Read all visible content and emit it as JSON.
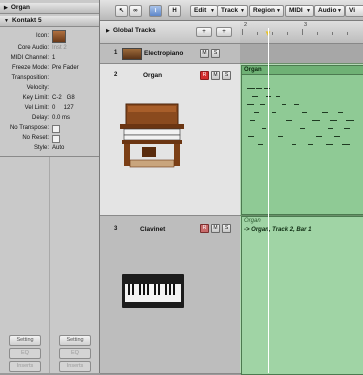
{
  "inspector": {
    "region_header": "Organ",
    "plugin_header": "Kontakt 5",
    "params": [
      {
        "label": "Icon:",
        "value": ""
      },
      {
        "label": "Core Audio:",
        "value": "Inst 2"
      },
      {
        "label": "MIDI Channel:",
        "value": "1"
      },
      {
        "label": "Freeze Mode:",
        "value": "Pre Fader"
      },
      {
        "label": "Transposition:",
        "value": ""
      },
      {
        "label": "Velocity:",
        "value": ""
      },
      {
        "label": "Key Limit:",
        "value": "C-2   G8"
      },
      {
        "label": "Vel Limit:",
        "value": "0     127"
      },
      {
        "label": "Delay:",
        "value": "0.0 ms"
      },
      {
        "label": "No Transpose:",
        "value": ""
      },
      {
        "label": "No Reset:",
        "value": ""
      },
      {
        "label": "Style:",
        "value": "Auto"
      }
    ],
    "buttons": {
      "setting": "Setting",
      "eq": "EQ",
      "inserts": "Inserts"
    }
  },
  "toolbar": {
    "edit": "Edit",
    "track": "Track",
    "region": "Region",
    "midi": "MIDI",
    "audio": "Audio",
    "view": "Vi",
    "h_label": "H"
  },
  "global_tracks": {
    "label": "Global Tracks",
    "add": "+",
    "add2": "+"
  },
  "ruler": {
    "marks": [
      "2",
      "3"
    ]
  },
  "tracks": [
    {
      "number": "1",
      "name": "Electropiano",
      "mute": "M",
      "solo": "S"
    },
    {
      "number": "2",
      "name": "Organ",
      "record": "R",
      "mute": "M",
      "solo": "S"
    },
    {
      "number": "3",
      "name": "Clavinet",
      "record": "R",
      "mute": "M",
      "solo": "S"
    }
  ],
  "regions": {
    "organ": {
      "title": "Organ"
    },
    "alias": {
      "title": "Organ",
      "subtitle": "-> Organ, Track 2, Bar 1"
    }
  },
  "colors": {
    "region": "#8fca95",
    "record": "#d32c2c",
    "selected_tool": "#5d86c9"
  }
}
